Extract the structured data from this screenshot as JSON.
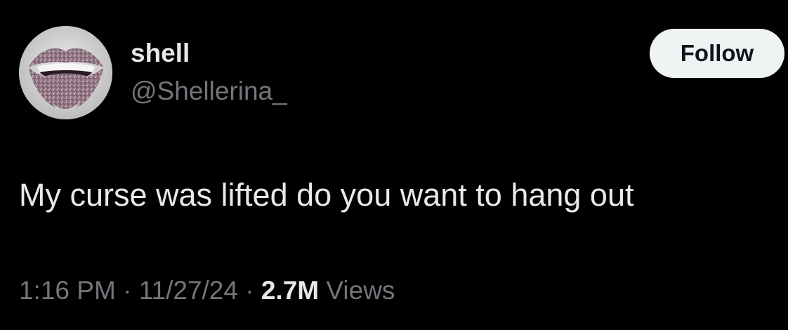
{
  "author": {
    "display_name": "shell",
    "handle": "@Shellerina_"
  },
  "follow_button": {
    "label": "Follow"
  },
  "tweet": {
    "text": "My curse was lifted do you want to hang out"
  },
  "meta": {
    "time": "1:16 PM",
    "separator_1": " · ",
    "date": "11/27/24",
    "separator_2": " · ",
    "views_count": "2.7M",
    "views_label": " Views"
  },
  "colors": {
    "background": "#000000",
    "primary_text": "#e7e9ea",
    "secondary_text": "#71767b",
    "follow_bg": "#eff3f4",
    "follow_text": "#0f1419"
  },
  "icons": {
    "avatar": "glitter-lips-avatar"
  }
}
